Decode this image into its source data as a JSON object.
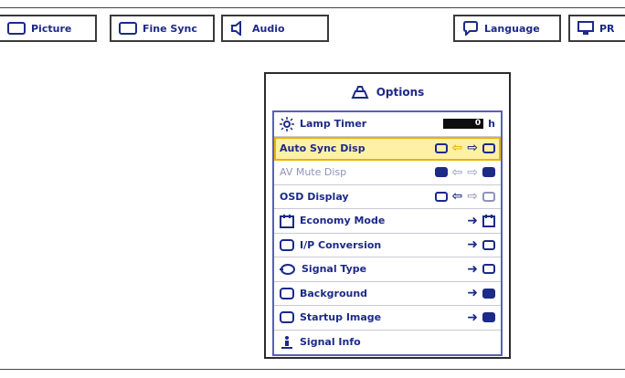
{
  "tabs": {
    "picture": "Picture",
    "fine_sync": "Fine Sync",
    "audio": "Audio",
    "language": "Language",
    "pr": "PR"
  },
  "options": {
    "title": "Options",
    "lamp_timer": {
      "label": "Lamp Timer",
      "value": "0",
      "unit": "h"
    },
    "items": {
      "auto_sync_disp": "Auto Sync Disp",
      "av_mute_disp": "AV Mute Disp",
      "osd_display": "OSD Display",
      "economy_mode": "Economy Mode",
      "ip_conversion": "I/P Conversion",
      "signal_type": "Signal Type",
      "background": "Background",
      "startup_image": "Startup Image",
      "signal_info": "Signal Info"
    }
  },
  "colors": {
    "accent": "#1c2a88",
    "highlight": "#fff0a8",
    "highlight_border": "#e8b400",
    "menu_border": "#5a5fb8"
  }
}
